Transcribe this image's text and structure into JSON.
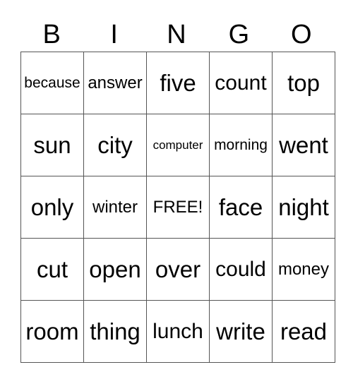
{
  "header": [
    "B",
    "I",
    "N",
    "G",
    "O"
  ],
  "rows": [
    [
      "because",
      "answer",
      "five",
      "count",
      "top"
    ],
    [
      "sun",
      "city",
      "computer",
      "morning",
      "went"
    ],
    [
      "only",
      "winter",
      "FREE!",
      "face",
      "night"
    ],
    [
      "cut",
      "open",
      "over",
      "could",
      "money"
    ],
    [
      "room",
      "thing",
      "lunch",
      "write",
      "read"
    ]
  ]
}
